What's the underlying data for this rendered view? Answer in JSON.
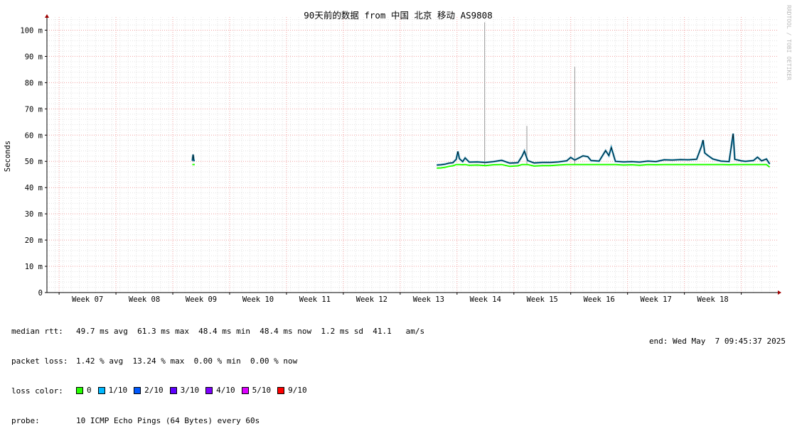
{
  "chart_data": {
    "type": "line",
    "title": "90天前的数据 from 中国 北京 移动 AS9808",
    "ylabel": "Seconds",
    "xlabel": "",
    "ylim": [
      0,
      105
    ],
    "y_ticks": [
      {
        "v": 0,
        "label": "0"
      },
      {
        "v": 10,
        "label": "10 m"
      },
      {
        "v": 20,
        "label": "20 m"
      },
      {
        "v": 30,
        "label": "30 m"
      },
      {
        "v": 40,
        "label": "40 m"
      },
      {
        "v": 50,
        "label": "50 m"
      },
      {
        "v": 60,
        "label": "60 m"
      },
      {
        "v": 70,
        "label": "70 m"
      },
      {
        "v": 80,
        "label": "80 m"
      },
      {
        "v": 90,
        "label": "90 m"
      },
      {
        "v": 100,
        "label": "100 m"
      }
    ],
    "x_range_days": [
      0,
      90
    ],
    "week_ticks": [
      {
        "day": 5,
        "label": "Week 07"
      },
      {
        "day": 12,
        "label": "Week 08"
      },
      {
        "day": 19,
        "label": "Week 09"
      },
      {
        "day": 26,
        "label": "Week 10"
      },
      {
        "day": 33,
        "label": "Week 11"
      },
      {
        "day": 40,
        "label": "Week 12"
      },
      {
        "day": 47,
        "label": "Week 13"
      },
      {
        "day": 54,
        "label": "Week 14"
      },
      {
        "day": 61,
        "label": "Week 15"
      },
      {
        "day": 68,
        "label": "Week 16"
      },
      {
        "day": 75,
        "label": "Week 17"
      },
      {
        "day": 82,
        "label": "Week 18"
      }
    ],
    "grid": true,
    "watermark": "RRDTOOL / TOBI OETIKER",
    "series": [
      {
        "name": "median rtt",
        "unit": "ms",
        "points": [
          [
            17.9,
            50.2
          ],
          [
            18.0,
            52.6
          ],
          [
            18.1,
            50.3
          ],
          [
            18.2,
            50.4
          ],
          [
            48.0,
            48.6
          ],
          [
            48.5,
            48.7
          ],
          [
            49.0,
            48.9
          ],
          [
            49.5,
            49.3
          ],
          [
            50.0,
            49.5
          ],
          [
            50.4,
            50.8
          ],
          [
            50.6,
            53.8
          ],
          [
            50.8,
            51.0
          ],
          [
            51.2,
            49.9
          ],
          [
            51.5,
            51.3
          ],
          [
            52.0,
            49.7
          ],
          [
            53.0,
            49.8
          ],
          [
            54.0,
            49.6
          ],
          [
            55.0,
            49.9
          ],
          [
            56.0,
            50.4
          ],
          [
            57.0,
            49.3
          ],
          [
            58.0,
            49.5
          ],
          [
            58.5,
            51.9
          ],
          [
            58.8,
            53.9
          ],
          [
            59.2,
            50.3
          ],
          [
            60.0,
            49.4
          ],
          [
            61.0,
            49.6
          ],
          [
            62.0,
            49.6
          ],
          [
            63.0,
            49.8
          ],
          [
            64.0,
            50.2
          ],
          [
            64.5,
            51.5
          ],
          [
            65.0,
            50.5
          ],
          [
            66.0,
            52.1
          ],
          [
            66.6,
            51.8
          ],
          [
            67.0,
            50.3
          ],
          [
            68.0,
            50.1
          ],
          [
            68.8,
            54.1
          ],
          [
            69.2,
            52.2
          ],
          [
            69.5,
            55.3
          ],
          [
            70.0,
            50.0
          ],
          [
            71.0,
            49.8
          ],
          [
            72.0,
            49.9
          ],
          [
            73.0,
            49.7
          ],
          [
            74.0,
            50.1
          ],
          [
            75.0,
            49.9
          ],
          [
            76.0,
            50.6
          ],
          [
            77.0,
            50.5
          ],
          [
            78.0,
            50.7
          ],
          [
            79.0,
            50.6
          ],
          [
            80.0,
            50.8
          ],
          [
            80.6,
            55.7
          ],
          [
            80.8,
            58.1
          ],
          [
            81.0,
            53.2
          ],
          [
            81.4,
            52.2
          ],
          [
            82.0,
            50.9
          ],
          [
            83.0,
            50.1
          ],
          [
            84.0,
            49.9
          ],
          [
            84.5,
            60.6
          ],
          [
            84.7,
            50.8
          ],
          [
            85.5,
            50.2
          ],
          [
            86.0,
            50.0
          ],
          [
            87.0,
            50.3
          ],
          [
            87.5,
            51.6
          ],
          [
            88.0,
            50.2
          ],
          [
            88.6,
            50.9
          ],
          [
            89.0,
            49.0
          ]
        ]
      }
    ],
    "spikes": [
      {
        "day": 53.9,
        "value": 103
      },
      {
        "day": 59.1,
        "value": 63.5
      },
      {
        "day": 65.0,
        "value": 86
      }
    ]
  },
  "stats": {
    "rtt_label": "median rtt:",
    "rtt_value": "49.7 ms avg  61.3 ms max  48.4 ms min  48.4 ms now  1.2 ms sd  41.1   am/s",
    "loss_label": "packet loss:",
    "loss_value": "1.42 % avg  13.24 % max  0.00 % min  0.00 % now",
    "color_label": "loss color:",
    "loss_colors": [
      {
        "label": "0",
        "color": "#26ff00"
      },
      {
        "label": "1/10",
        "color": "#00b8ff"
      },
      {
        "label": "2/10",
        "color": "#0059ff"
      },
      {
        "label": "3/10",
        "color": "#5e00ff"
      },
      {
        "label": "4/10",
        "color": "#7e00ff"
      },
      {
        "label": "5/10",
        "color": "#dd00ff"
      },
      {
        "label": "9/10",
        "color": "#ff0000"
      }
    ],
    "probe_label": "probe:",
    "probe_value": "10 ICMP Echo Pings (64 Bytes) every 60s",
    "end_text": "end: Wed May  7 09:45:37 2025"
  }
}
